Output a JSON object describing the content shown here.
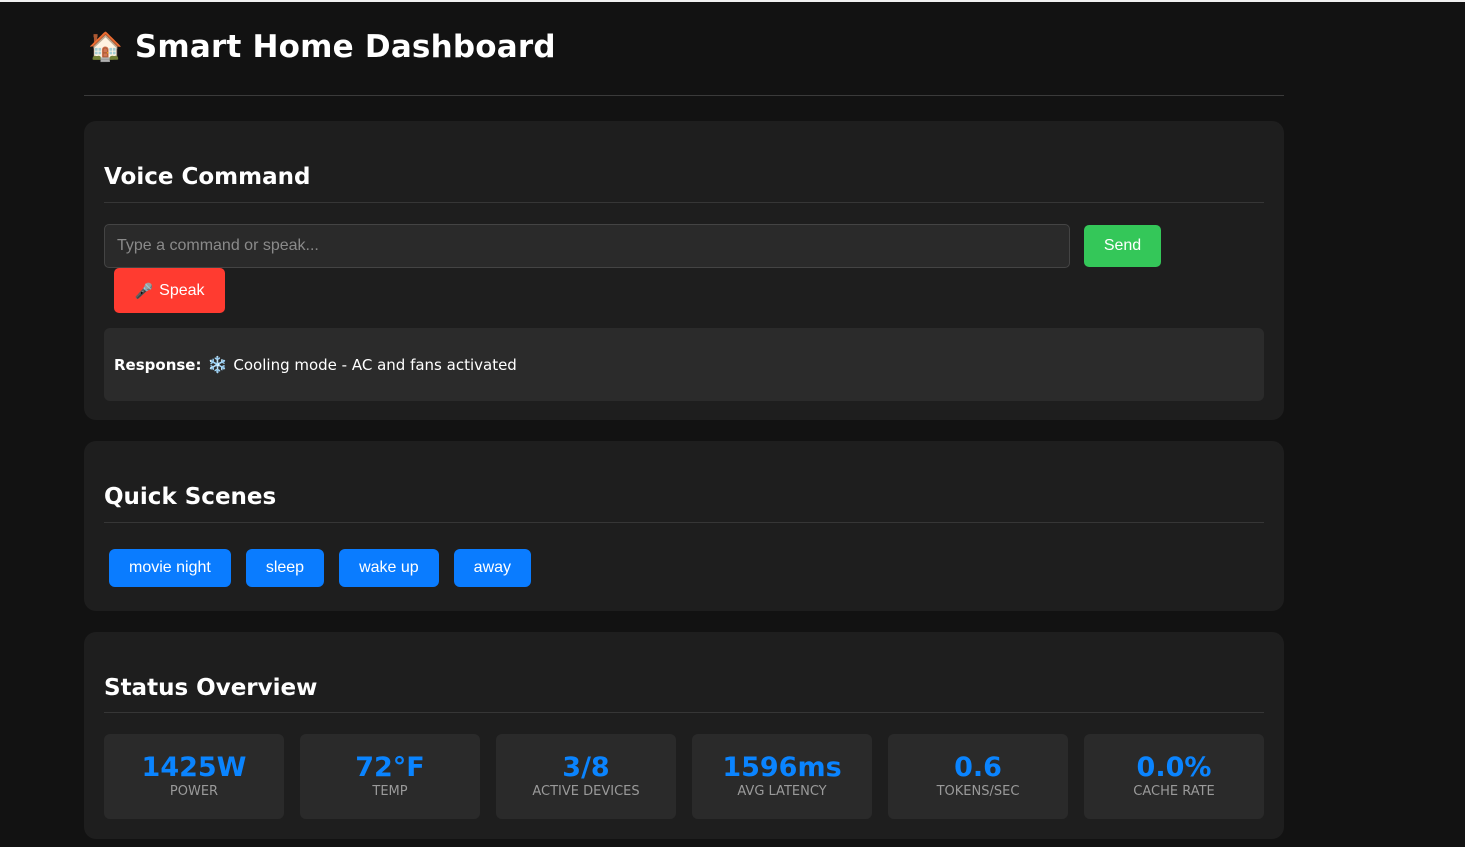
{
  "header": {
    "emoji": "🏠",
    "title": "Smart Home Dashboard"
  },
  "voice": {
    "title": "Voice Command",
    "input_placeholder": "Type a command or speak...",
    "input_value": "",
    "send_label": "Send",
    "speak_icon": "🎤",
    "speak_label": "Speak",
    "response_label": "Response:",
    "response_icon": "❄️",
    "response_text": "Cooling mode - AC and fans activated"
  },
  "scenes": {
    "title": "Quick Scenes",
    "items": [
      {
        "label": "movie night"
      },
      {
        "label": "sleep"
      },
      {
        "label": "wake up"
      },
      {
        "label": "away"
      }
    ]
  },
  "status": {
    "title": "Status Overview",
    "stats": [
      {
        "value": "1425W",
        "label": "Power"
      },
      {
        "value": "72°F",
        "label": "Temp"
      },
      {
        "value": "3/8",
        "label": "Active Devices"
      },
      {
        "value": "1596ms",
        "label": "Avg Latency"
      },
      {
        "value": "0.6",
        "label": "Tokens/sec"
      },
      {
        "value": "0.0%",
        "label": "Cache Rate"
      }
    ]
  },
  "colors": {
    "background": "#121212",
    "card": "#1e1e1e",
    "send": "#34c759",
    "speak": "#ff3b30",
    "scene": "#0a7cff",
    "stat_value": "#0a84ff"
  }
}
